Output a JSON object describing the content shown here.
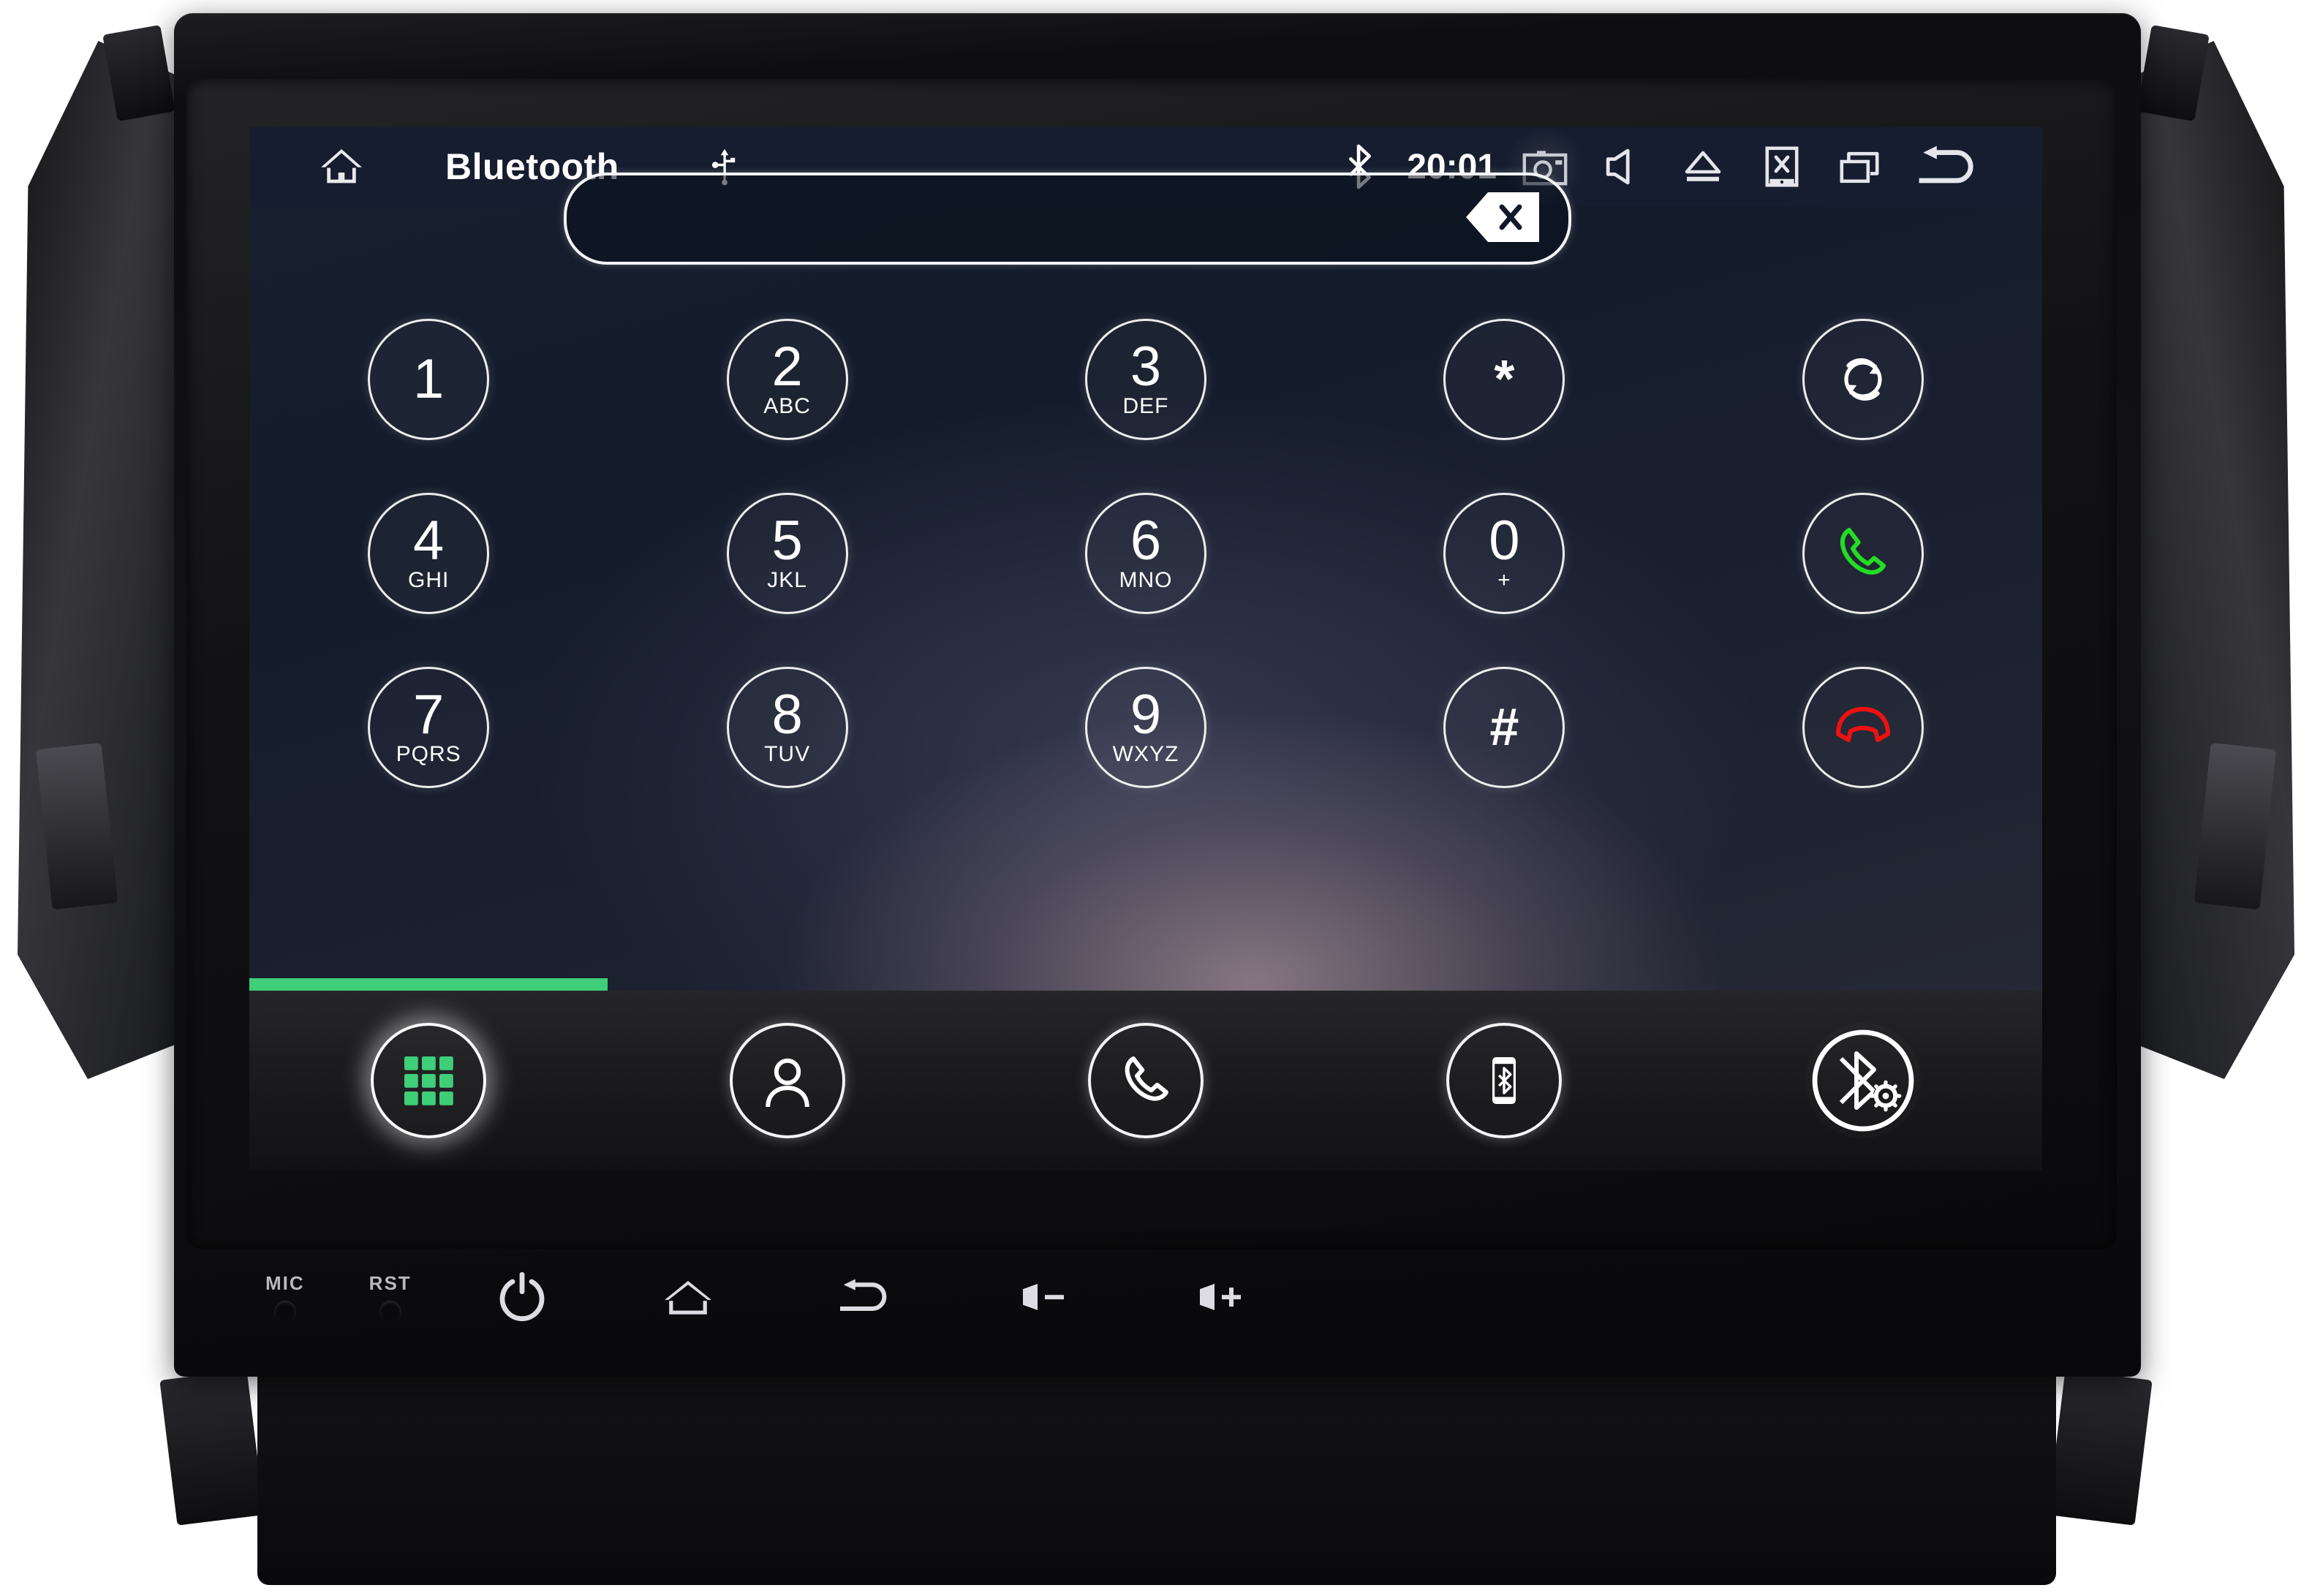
{
  "device": {
    "hardware_buttons": [
      {
        "name": "mic",
        "label": "MIC",
        "type": "pinhole"
      },
      {
        "name": "reset",
        "label": "RST",
        "type": "pinhole"
      },
      {
        "name": "power",
        "label": "",
        "icon": "power-icon"
      },
      {
        "name": "home",
        "label": "",
        "icon": "home-icon"
      },
      {
        "name": "back",
        "label": "",
        "icon": "back-arrow-icon"
      },
      {
        "name": "volume-down",
        "label": "",
        "icon": "volume-down-icon"
      },
      {
        "name": "volume-up",
        "label": "",
        "icon": "volume-up-icon"
      }
    ]
  },
  "statusbar": {
    "home_icon": "home-icon",
    "title": "Bluetooth",
    "usb_icon": "usb-icon",
    "bluetooth_icon": "bluetooth-icon",
    "time": "20:01",
    "right_icons": [
      {
        "name": "screenshot-icon",
        "highlighted": true
      },
      {
        "name": "mute-speaker-icon",
        "highlighted": false
      },
      {
        "name": "eject-icon",
        "highlighted": false
      },
      {
        "name": "screen-off-icon",
        "highlighted": false
      },
      {
        "name": "recent-apps-icon",
        "highlighted": false
      },
      {
        "name": "back-icon",
        "highlighted": false
      }
    ]
  },
  "dialer": {
    "input_value": "",
    "input_placeholder": "",
    "backspace_icon": "backspace-icon",
    "keys": [
      {
        "digit": "1",
        "letters": "",
        "type": "digit"
      },
      {
        "digit": "2",
        "letters": "ABC",
        "type": "digit"
      },
      {
        "digit": "3",
        "letters": "DEF",
        "type": "digit"
      },
      {
        "digit": "*",
        "letters": "",
        "type": "symbol"
      },
      {
        "digit": "",
        "letters": "",
        "type": "transfer-audio"
      },
      {
        "digit": "4",
        "letters": "GHI",
        "type": "digit"
      },
      {
        "digit": "5",
        "letters": "JKL",
        "type": "digit"
      },
      {
        "digit": "6",
        "letters": "MNO",
        "type": "digit"
      },
      {
        "digit": "0",
        "letters": "+",
        "type": "digit"
      },
      {
        "digit": "",
        "letters": "",
        "type": "call"
      },
      {
        "digit": "7",
        "letters": "PQRS",
        "type": "digit"
      },
      {
        "digit": "8",
        "letters": "TUV",
        "type": "digit"
      },
      {
        "digit": "9",
        "letters": "WXYZ",
        "type": "digit"
      },
      {
        "digit": "#",
        "letters": "",
        "type": "symbol"
      },
      {
        "digit": "",
        "letters": "",
        "type": "end-call"
      }
    ]
  },
  "tabbar": {
    "items": [
      {
        "name": "dialpad",
        "icon": "dialpad-grid-icon",
        "active": true
      },
      {
        "name": "contacts",
        "icon": "contact-person-icon",
        "active": false
      },
      {
        "name": "call-log",
        "icon": "handset-icon",
        "active": false
      },
      {
        "name": "bt-phone",
        "icon": "phone-bluetooth-icon",
        "active": false
      },
      {
        "name": "bt-settings",
        "icon": "bluetooth-settings-icon",
        "active": false
      }
    ]
  },
  "colors": {
    "accent_green": "#3ecf78",
    "call_green": "#22dd22",
    "end_red": "#ee1111",
    "statusbar_bg": "#161d2e",
    "screen_bg": "#17202f"
  }
}
